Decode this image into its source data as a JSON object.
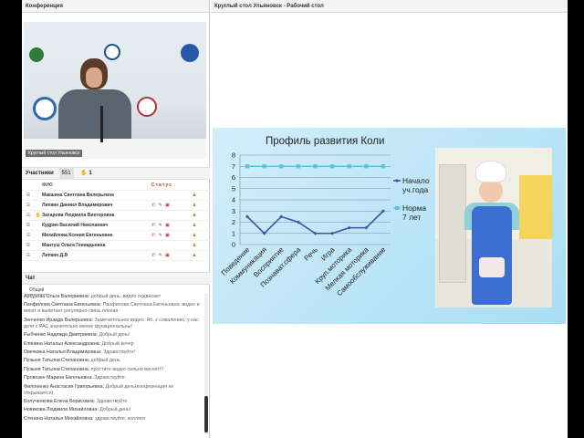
{
  "conference": {
    "title": "Конференция",
    "video_caption": "Круглый стол Ульяновск"
  },
  "participants": {
    "title": "Участники",
    "count": "551",
    "hand_count": "1",
    "col_name": "ФИО",
    "col_status": "Статус",
    "rows": [
      {
        "name": "Макшина Светлана Валерьевна",
        "status": "",
        "hand": ""
      },
      {
        "name": "Липкин Даниил Владимирович",
        "status": "✆ ✎ ▣",
        "hand": ""
      },
      {
        "name": "Захарова Людмила Викторовна",
        "status": "",
        "hand": "✋"
      },
      {
        "name": "Кудрин Василий Николаевич",
        "status": "✆ ✎ ▣",
        "hand": ""
      },
      {
        "name": "Михайлова Ксения Евгеньевна",
        "status": "✆ ✎ ▣",
        "hand": ""
      },
      {
        "name": "Мантуш Ольга Геннадьевна",
        "status": "",
        "hand": ""
      },
      {
        "name": "Липкин Д.В",
        "status": "✆ ✎ ▣",
        "hand": ""
      }
    ]
  },
  "chat": {
    "title": "Чат",
    "tab": "Общий",
    "messages": [
      {
        "author": "Арбузова Ольга Валериевна:",
        "text": "добрый день, видео подвисает"
      },
      {
        "author": "Панфилова Светлана Евгеньевна:",
        "text": "Панфилова Светлана Евгеньевна: видео и висит и вылетает регулярно-связь плохая"
      },
      {
        "author": "Зенченко Ираида Валерьевна:",
        "text": "Замечательное видео. Но, к сожалению, у нас дети с РАС значительно менее функциональны!"
      },
      {
        "author": "Рыбченко Надежда Дмитриевна:",
        "text": "Добрый день!"
      },
      {
        "author": "Клянина Наталья Александровна:",
        "text": "Добрый вечер"
      },
      {
        "author": "Овечкина Наталья Владимировна:",
        "text": "Здравствуйте!"
      },
      {
        "author": "Пузыня Татьяна Степановна:",
        "text": "добрый день"
      },
      {
        "author": "Пузыня Татьяна Степановна:",
        "text": "простите видео сильно виснет!!!"
      },
      {
        "author": "Провозен Марина Евгеньевна:",
        "text": "Здравствуйте ."
      },
      {
        "author": "Филоненко Анастасия Григорьевна:",
        "text": "Добрый день(конференция не открывается)"
      },
      {
        "author": "Болученкова Елена Борисовна:",
        "text": "Здравствуйте"
      },
      {
        "author": "Новикова Людмила Михайловна:",
        "text": "Добрый день!"
      },
      {
        "author": "Стенина Наталья Михайловна:",
        "text": "здравствуйте, коллеги"
      }
    ]
  },
  "desktop": {
    "title": "Круглый стол Ульяновск - Рабочий стол"
  },
  "chart_data": {
    "type": "line",
    "title": "Профиль развития Коли",
    "categories": [
      "Поведение",
      "Коммуникация",
      "Восприятие",
      "Познават.сфера",
      "Речь",
      "Игра",
      "Круп.моторика",
      "Мелкая моторика",
      "Самообслуживание"
    ],
    "series": [
      {
        "name": "Начало уч.года",
        "values": [
          2.5,
          1,
          2.5,
          2,
          1,
          1,
          1.5,
          1.5,
          3
        ],
        "color": "#3a55a4"
      },
      {
        "name": "Норма 7 лет",
        "values": [
          7,
          7,
          7,
          7,
          7,
          7,
          7,
          7,
          7
        ],
        "color": "#57c3e6"
      }
    ],
    "yticks": [
      "0",
      "1",
      "2",
      "3",
      "4",
      "5",
      "6",
      "7",
      "8"
    ],
    "ylim": [
      0,
      8
    ],
    "grid": true,
    "legend": "right"
  },
  "colors": {
    "slide_bg": "#a9ddf4",
    "accent_orange": "#c57a2b"
  }
}
